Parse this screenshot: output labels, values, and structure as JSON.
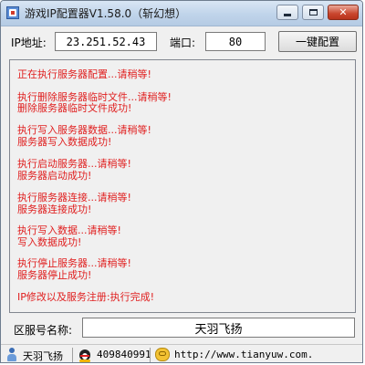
{
  "window": {
    "title": "游戏IP配置器V1.58.0（斩幻想）",
    "close_glyph": "✕"
  },
  "config": {
    "ip_label": "IP地址:",
    "ip_value": "23.251.52.43",
    "port_label": "端口:",
    "port_value": "80",
    "button_label": "一键配置"
  },
  "log": {
    "lines": [
      "正在执行服务器配置...请稍等!",
      "执行删除服务器临时文件...请稍等!",
      "删除服务器临时文件成功!",
      "执行写入服务器数据...请稍等!",
      "服务器写入数据成功!",
      "执行启动服务器...请稍等!",
      "服务器启动成功!",
      "执行服务器连接...请稍等!",
      "服务器连接成功!",
      "执行写入数据...请稍等!",
      "写入数据成功!",
      "执行停止服务器...请稍等!",
      "服务器停止成功!",
      "IP修改以及服务注册:执行完成!"
    ]
  },
  "server": {
    "label": "区服号名称:",
    "value": "天羽飞扬"
  },
  "statusbar": {
    "author": "天羽飞扬",
    "qq": "409840991",
    "url": "http://www.tianyuw.com."
  },
  "icons": {
    "app": "app-icon",
    "user": "user-icon",
    "qq": "qq-penguin-icon",
    "web": "web-link-icon"
  },
  "colors": {
    "log_text": "#e02020",
    "titlebar": "#c0d4ea"
  }
}
